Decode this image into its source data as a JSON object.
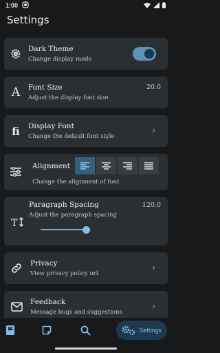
{
  "status_bar": {
    "time": "1:00"
  },
  "app": {
    "title": "Settings"
  },
  "settings": {
    "dark_theme": {
      "title": "Dark Theme",
      "subtitle": "Change display mode",
      "enabled": true
    },
    "font_size": {
      "title": "Font Size",
      "subtitle": "Adjust the display font size",
      "value": "20.0"
    },
    "display_font": {
      "title": "Display Font",
      "subtitle": "Change the default font style"
    },
    "alignment": {
      "title": "Alignment",
      "subtitle": "Change the alignment of font",
      "options": [
        "left",
        "center",
        "right",
        "justify"
      ],
      "selected": "left"
    },
    "paragraph_spacing": {
      "title": "Paragraph Spacing",
      "subtitle": "Adjust the paragraph spacing",
      "value": "120.0"
    },
    "privacy": {
      "title": "Privacy",
      "subtitle": "View privacy policy url"
    },
    "feedback": {
      "title": "Feedback",
      "subtitle": "Message bugs and suggestions"
    }
  },
  "bottom_nav": {
    "items": [
      "book-icon",
      "note-icon",
      "search-icon",
      "settings-icon"
    ],
    "active_label": "Settings"
  },
  "colors": {
    "accent": "#7cc0ea",
    "card": "#2c2f31",
    "background": "#17191b"
  }
}
